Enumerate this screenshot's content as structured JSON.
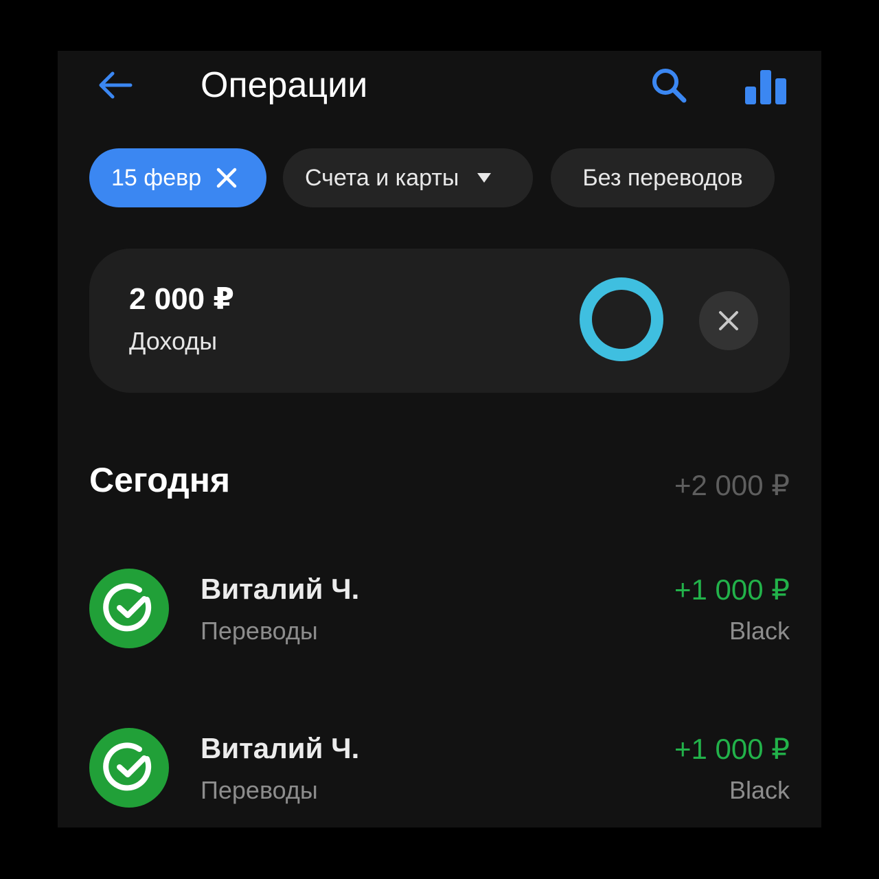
{
  "header": {
    "title": "Операции",
    "back_icon": "arrow-left-icon",
    "search_icon": "search-icon",
    "stats_icon": "bar-chart-icon",
    "accent_color": "#3b87f2"
  },
  "filters": {
    "date_chip": {
      "label": "15 февр",
      "icon": "close-icon"
    },
    "accounts_chip": {
      "label": "Счета и карты",
      "icon": "caret-down-icon"
    },
    "transfers_chip": {
      "label": "Без переводов"
    }
  },
  "summary": {
    "amount": "2 000 ₽",
    "label": "Доходы",
    "donut_color": "#3fbfe0",
    "close_icon": "close-icon"
  },
  "section": {
    "title": "Сегодня",
    "total": "+2 000 ₽"
  },
  "operations": [
    {
      "name": "Виталий Ч.",
      "category": "Переводы",
      "amount": "+1 000 ₽",
      "account": "Black",
      "icon": "sber-check-icon",
      "icon_color": "#21a038"
    },
    {
      "name": "Виталий Ч.",
      "category": "Переводы",
      "amount": "+1 000 ₽",
      "account": "Black",
      "icon": "sber-check-icon",
      "icon_color": "#21a038"
    }
  ]
}
